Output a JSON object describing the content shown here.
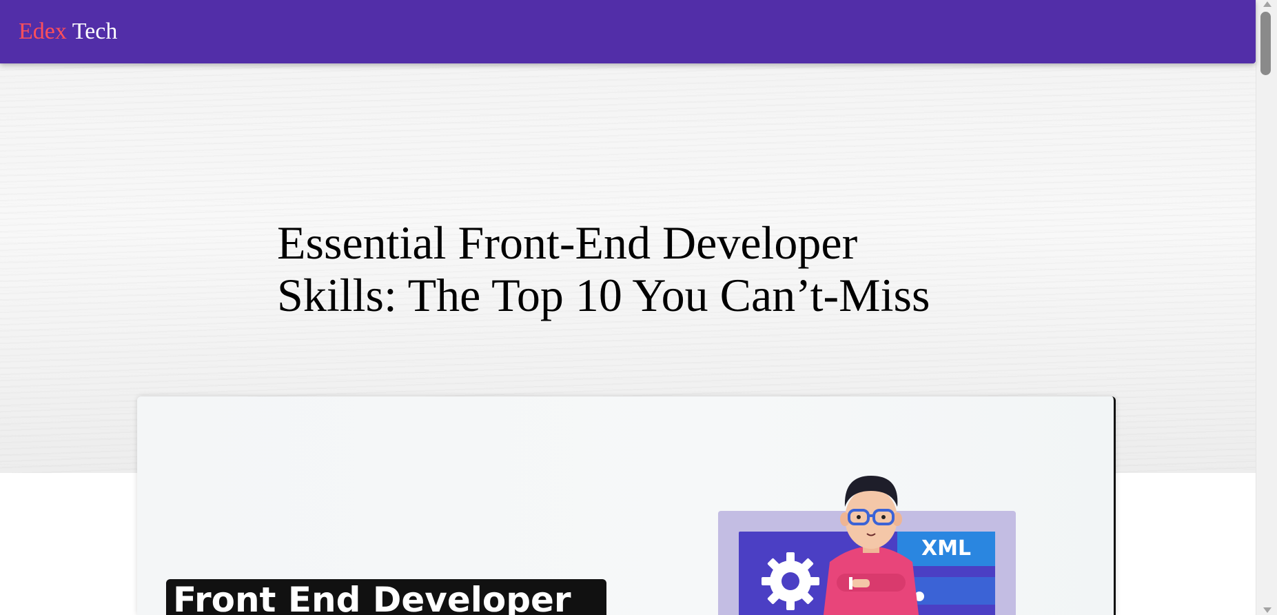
{
  "navbar": {
    "brand_part1": "Edex",
    "brand_part2": "Tech",
    "background_color": "#522ea8",
    "brand_accent_color": "#ff4f5a"
  },
  "hero": {
    "title_line1": "Essential Front-End Developer",
    "title_line2": "Skills: The Top 10 You Can’t-Miss"
  },
  "feature_image": {
    "banner_text": "Front End Developer",
    "tag_text": "XML",
    "icons": [
      "gear-icon",
      "developer-character"
    ]
  },
  "scrollbar": {
    "thumb_color": "#8a8a8a"
  }
}
